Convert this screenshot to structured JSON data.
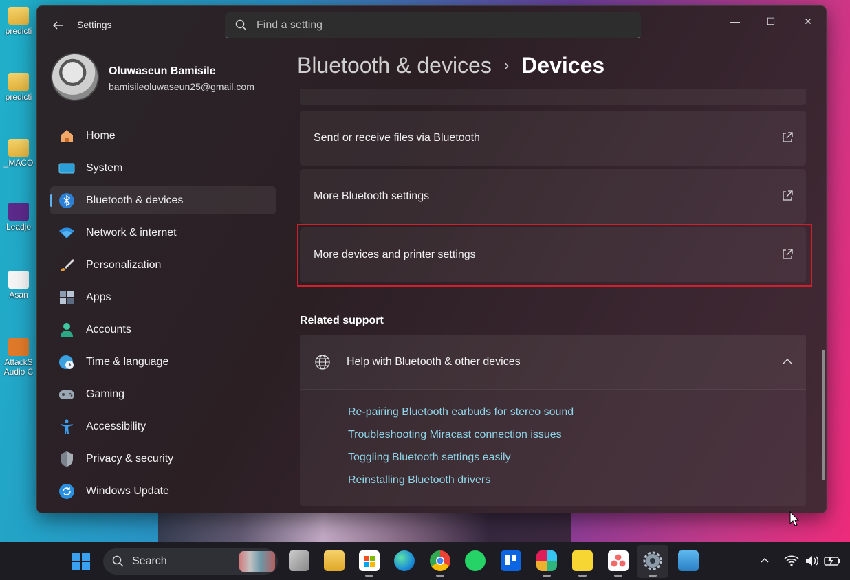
{
  "desktop": {
    "icons": [
      {
        "label": "predicti"
      },
      {
        "label": "predicti"
      },
      {
        "label": "_MACO"
      },
      {
        "label": "Leadjo"
      },
      {
        "label": "Asan"
      },
      {
        "label": "AttackS Audio C"
      }
    ]
  },
  "window": {
    "title": "Settings",
    "search_placeholder": "Find a setting",
    "controls": {
      "minimize": "—",
      "maximize": "☐",
      "close": "✕"
    }
  },
  "profile": {
    "name": "Oluwaseun Bamisile",
    "email": "bamisileoluwaseun25@gmail.com"
  },
  "sidebar": {
    "items": [
      {
        "label": "Home",
        "icon": "home-icon"
      },
      {
        "label": "System",
        "icon": "system-icon"
      },
      {
        "label": "Bluetooth & devices",
        "icon": "bluetooth-icon",
        "active": true
      },
      {
        "label": "Network & internet",
        "icon": "wifi-icon"
      },
      {
        "label": "Personalization",
        "icon": "brush-icon"
      },
      {
        "label": "Apps",
        "icon": "apps-icon"
      },
      {
        "label": "Accounts",
        "icon": "accounts-icon"
      },
      {
        "label": "Time & language",
        "icon": "globe-clock-icon"
      },
      {
        "label": "Gaming",
        "icon": "gamepad-icon"
      },
      {
        "label": "Accessibility",
        "icon": "accessibility-icon"
      },
      {
        "label": "Privacy & security",
        "icon": "shield-icon"
      },
      {
        "label": "Windows Update",
        "icon": "update-icon"
      }
    ]
  },
  "breadcrumb": {
    "parent": "Bluetooth & devices",
    "separator": "›",
    "current": "Devices"
  },
  "settings_rows": [
    {
      "label": "Send or receive files via Bluetooth"
    },
    {
      "label": "More Bluetooth settings"
    },
    {
      "label": "More devices and printer settings",
      "highlighted": true
    }
  ],
  "related_support": {
    "title": "Related support",
    "header": "Help with Bluetooth & other devices",
    "links": [
      "Re-pairing Bluetooth earbuds for stereo sound",
      "Troubleshooting Miracast connection issues",
      "Toggling Bluetooth settings easily",
      "Reinstalling Bluetooth drivers"
    ]
  },
  "taskbar": {
    "search_label": "Search",
    "apps": [
      "task-view",
      "file-explorer",
      "microsoft-store",
      "edge",
      "chrome",
      "whatsapp",
      "trello",
      "slack",
      "sticky-notes",
      "asana",
      "settings",
      "remote-desktop"
    ],
    "tray": {
      "chevron": "^",
      "wifi": "wifi-icon",
      "volume": "volume-icon",
      "battery": "battery-icon"
    }
  },
  "colors": {
    "accent": "#5fb2f2",
    "link": "#8fd4e8",
    "highlight_border": "#d21f2b"
  }
}
